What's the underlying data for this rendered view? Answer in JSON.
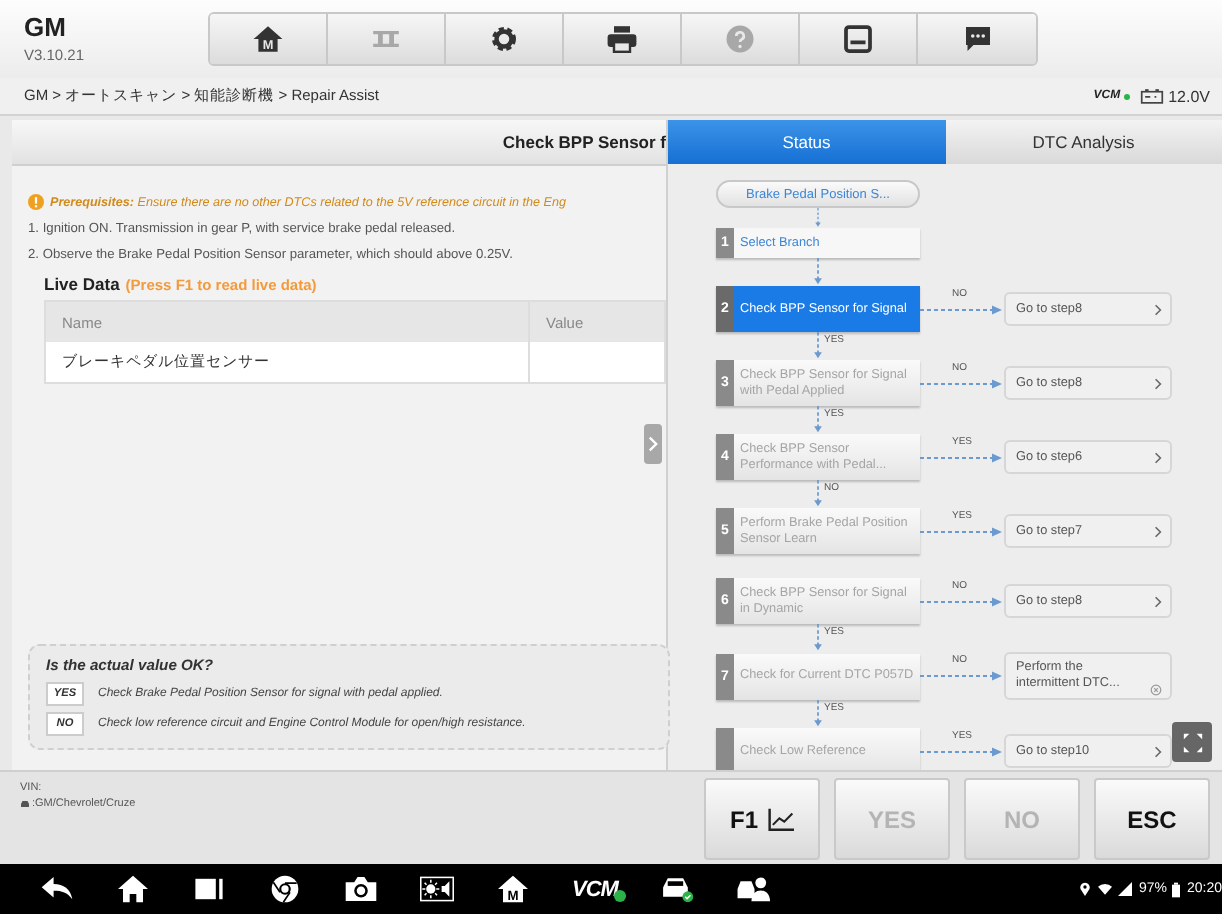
{
  "app": {
    "title": "GM",
    "version": "V3.10.21"
  },
  "toolbar": [
    {
      "kind": "home",
      "label": "M",
      "disabled": false
    },
    {
      "kind": "lift",
      "disabled": true
    },
    {
      "kind": "settings",
      "disabled": false
    },
    {
      "kind": "print",
      "disabled": false
    },
    {
      "kind": "help",
      "disabled": true
    },
    {
      "kind": "save",
      "disabled": false
    },
    {
      "kind": "message",
      "disabled": false
    }
  ],
  "breadcrumb": "GM > オートスキャン > 知能診断機 > Repair Assist",
  "vci": {
    "label": "VCM",
    "connected": true,
    "voltage": "12.0V"
  },
  "left_panel": {
    "title": "Check BPP Sensor f",
    "prerequisite": "**Prerequisites:** Ensure there are no other DTCs related to the 5V reference circuit in the Eng",
    "instructions": [
      "1. Ignition ON. Transmission in gear P, with service brake pedal released.",
      "2. Observe the Brake Pedal Position Sensor parameter, which should above 0.25V."
    ],
    "live_data": {
      "title": "Live Data",
      "hint": "(Press F1 to read live data)",
      "columns": [
        "Name",
        "Value"
      ],
      "rows": [
        {
          "name": "ブレーキペダル位置センサー"
        }
      ]
    },
    "question": {
      "title": "Is the actual value OK?",
      "answers": [
        {
          "tag": "YES",
          "text": "Check Brake Pedal Position Sensor for signal with pedal applied."
        },
        {
          "tag": "NO",
          "text": "Check low reference circuit and Engine Control Module for open/high resistance."
        }
      ]
    },
    "vehicle": {
      "label": "VIN:",
      "path": ":GM/Chevrolet/Cruze"
    }
  },
  "tabs": [
    {
      "label": "Status",
      "selected": true
    },
    {
      "label": "DTC Analysis",
      "selected": false
    }
  ],
  "flow": {
    "start": {
      "text": "Brake Pedal Position S...",
      "connector": true
    },
    "steps": [
      {
        "number": "1",
        "text": "Select Branch",
        "done": true,
        "active": false,
        "connector": true
      },
      {
        "number": "2",
        "text": "Check BPP Sensor for Signal",
        "done": false,
        "active": true,
        "branch": {
          "label": "NO",
          "target": "Go to step8",
          "kind": "goto"
        },
        "down_label": "YES",
        "connector": true
      },
      {
        "number": "3",
        "text": "Check BPP Sensor for Signal with Pedal Applied",
        "done": false,
        "active": false,
        "branch": {
          "label": "NO",
          "target": "Go to step8",
          "kind": "goto"
        },
        "down_label": "YES",
        "connector": true
      },
      {
        "number": "4",
        "text": "Check BPP Sensor Performance with Pedal...",
        "done": false,
        "active": false,
        "branch": {
          "label": "YES",
          "target": "Go to step6",
          "kind": "goto"
        },
        "down_label": "NO",
        "connector": true
      },
      {
        "number": "5",
        "text": "Perform Brake Pedal Position Sensor Learn",
        "done": false,
        "active": false,
        "branch": {
          "label": "YES",
          "target": "Go to step7",
          "kind": "goto"
        },
        "connector": false
      },
      {
        "number": "6",
        "text": "Check BPP Sensor for Signal in Dynamic",
        "done": false,
        "active": false,
        "branch": {
          "label": "NO",
          "target": "Go to step8",
          "kind": "goto"
        },
        "down_label": "YES",
        "connector": true
      },
      {
        "number": "7",
        "text": "Check for Current DTC P057D",
        "done": false,
        "active": false,
        "branch": {
          "label": "NO",
          "target": "Perform the intermittent DTC...",
          "kind": "info"
        },
        "down_label": "YES",
        "connector": true
      },
      {
        "text": "Check Low Reference",
        "done": false,
        "active": false,
        "branch": {
          "label": "YES",
          "target": "Go to step10",
          "kind": "goto"
        }
      }
    ]
  },
  "actions": [
    {
      "label": "F1",
      "kind": "livedata",
      "disabled": false
    },
    {
      "label": "YES",
      "kind": "plain",
      "disabled": true
    },
    {
      "label": "NO",
      "kind": "plain",
      "disabled": true
    },
    {
      "label": "ESC",
      "kind": "plain",
      "disabled": false
    }
  ],
  "nav": [
    {
      "kind": "back"
    },
    {
      "kind": "home"
    },
    {
      "kind": "recent"
    },
    {
      "kind": "browser"
    },
    {
      "kind": "camera"
    },
    {
      "kind": "display"
    },
    {
      "kind": "mhome",
      "label": "M"
    },
    {
      "kind": "vci",
      "label": "VCM"
    },
    {
      "kind": "car"
    },
    {
      "kind": "person"
    }
  ],
  "status": {
    "battery": "97%",
    "time": "20:20"
  }
}
